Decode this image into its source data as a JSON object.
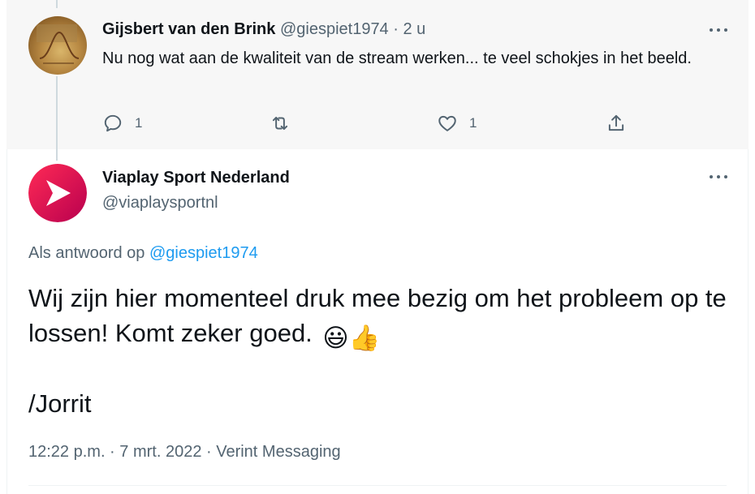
{
  "parent_tweet": {
    "author_name": "Gijsbert van den Brink",
    "author_handle": "@giespiet1974",
    "separator": "·",
    "time_ago": "2 u",
    "text": "Nu nog wat aan de kwaliteit van de stream werken... te veel schokjes in het beeld.",
    "reply_count": "1",
    "like_count": "1",
    "avatar_icon": "avatar-photo"
  },
  "main_tweet": {
    "author_name": "Viaplay Sport Nederland",
    "author_handle": "@viaplaysportnl",
    "reply_to_label": "Als antwoord op",
    "reply_to_handle": "@giespiet1974",
    "text": "Wij zijn hier momenteel druk mee bezig om het probleem op te lossen! Komt zeker goed.",
    "emojis": "😃👍",
    "signature": "/Jorrit",
    "timestamp": "12:22 p.m. · 7 mrt. 2022 · Verint Messaging"
  },
  "colors": {
    "accent": "#1d9bf0",
    "text_primary": "#0f1419",
    "text_secondary": "#536471",
    "parent_bg": "#f7f7f7",
    "viaplay_brand": "#e5005a"
  },
  "icons": {
    "more": "more-dots-icon",
    "reply": "reply-icon",
    "retweet": "retweet-icon",
    "like": "heart-icon",
    "share": "share-icon"
  }
}
